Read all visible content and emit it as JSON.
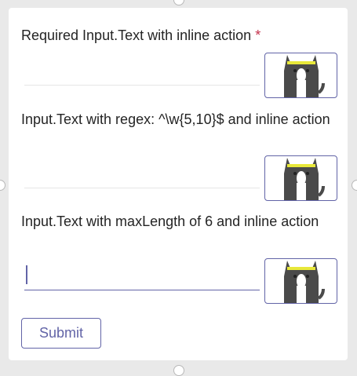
{
  "form": {
    "fields": [
      {
        "label": "Required Input.Text with inline action",
        "required_marker": "*",
        "value": "",
        "action_icon": "cat-image-icon"
      },
      {
        "label": "Input.Text with regex: ^\\w{5,10}$ and inline action",
        "value": "",
        "action_icon": "cat-image-icon"
      },
      {
        "label": "Input.Text with maxLength of 6 and inline action",
        "value": "",
        "focused": true,
        "action_icon": "cat-image-icon"
      }
    ],
    "submit_label": "Submit"
  },
  "colors": {
    "accent": "#6264a7",
    "required": "#c4314b",
    "text": "#242424",
    "background": "#e9e9e9"
  }
}
